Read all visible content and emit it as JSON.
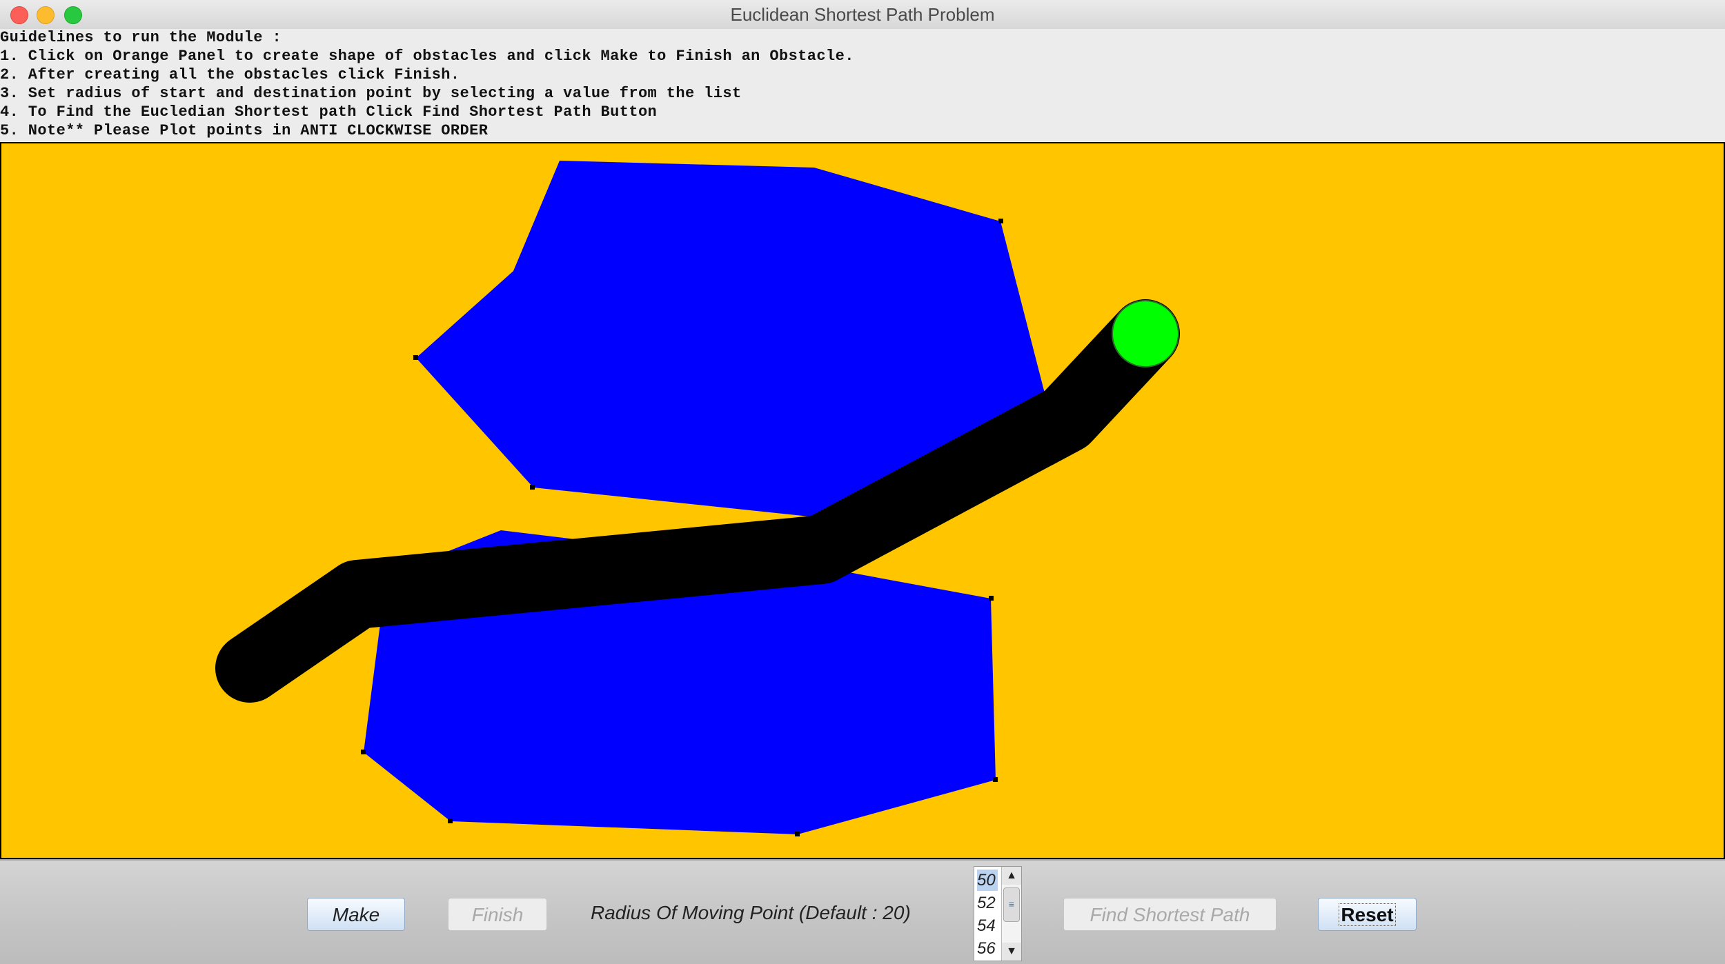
{
  "window": {
    "title": "Euclidean Shortest Path Problem"
  },
  "guidelines": [
    "Guidelines to run the Module :",
    "1. Click on Orange Panel to create shape of obstacles and click Make to Finish an Obstacle.",
    "2. After creating all the obstacles click Finish.",
    "3. Set radius of start and destination point by selecting a value from the list",
    "4. To Find the Eucledian Shortest path Click Find Shortest Path Button",
    "5. Note** Please Plot points in ANTI CLOCKWISE ORDER"
  ],
  "colors": {
    "panel": "#ffc600",
    "obstacle": "#0000ff",
    "path": "#000000",
    "moving_point": "#00ff00"
  },
  "controls": {
    "make_label": "Make",
    "finish_label": "Finish",
    "radius_label": "Radius Of Moving Point (Default : 20)",
    "find_label": "Find Shortest Path",
    "reset_label": "Reset",
    "radius_options": [
      "50",
      "52",
      "54",
      "56"
    ],
    "radius_selected": "50"
  }
}
